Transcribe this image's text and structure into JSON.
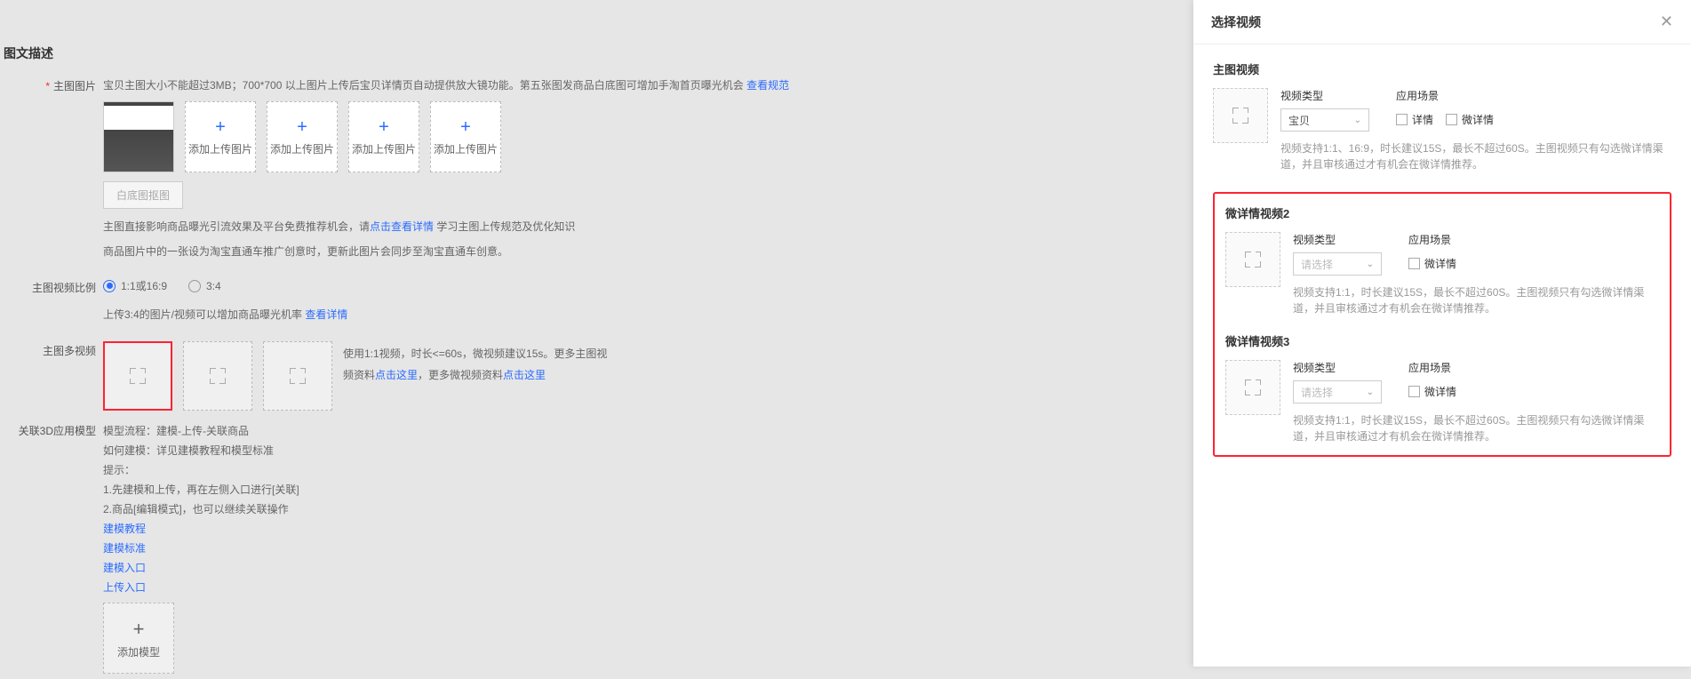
{
  "section_title": "图文描述",
  "main_image": {
    "label": "主图图片",
    "desc": "宝贝主图大小不能超过3MB；700*700 以上图片上传后宝贝详情页自动提供放大镜功能。第五张图发商品白底图可增加手淘首页曝光机会",
    "spec_link": "查看规范",
    "add_label": "添加上传图片",
    "gray_btn": "白底图抠图",
    "hint1_prefix": "主图直接影响商品曝光引流效果及平台免费推荐机会，请",
    "hint1_link": "点击查看详情",
    "hint1_suffix": "学习主图上传规范及优化知识",
    "hint2": "商品图片中的一张设为淘宝直通车推广创意时，更新此图片会同步至淘宝直通车创意。"
  },
  "ratio": {
    "label": "主图视频比例",
    "opt1": "1:1或16:9",
    "opt2": "3:4",
    "hint_prefix": "上传3:4的图片/视频可以增加商品曝光机率",
    "hint_link": "查看详情"
  },
  "multi_video": {
    "label": "主图多视频",
    "desc_prefix": "使用1:1视频，时长<=60s，微视频建议15s。更多主图视",
    "desc_mid": "频资料",
    "link1": "点击这里",
    "desc_suffix": "，更多微视频资料",
    "link2": "点击这里"
  },
  "model3d": {
    "label": "关联3D应用模型",
    "flow_label": "模型流程：",
    "flow_value": "建模-上传-关联商品",
    "how_label": "如何建模：",
    "how_value": "详见建模教程和模型标准",
    "tip_label": "提示：",
    "tip1": "1.先建模和上传，再在左侧入口进行[关联]",
    "tip2": "2.商品[编辑模式]，也可以继续关联操作",
    "link1": "建模教程",
    "link2": "建模标准",
    "link3": "建模入口",
    "link4": "上传入口",
    "add_label": "添加模型"
  },
  "panel": {
    "title": "选择视频",
    "sections": [
      {
        "title": "主图视频",
        "type_label": "视频类型",
        "type_value": "宝贝",
        "scene_label": "应用场景",
        "checks": [
          "详情",
          "微详情"
        ],
        "hint": "视频支持1:1、16:9，时长建议15S，最长不超过60S。主图视频只有勾选微详情渠道，并且审核通过才有机会在微详情推荐。"
      },
      {
        "title": "微详情视频2",
        "type_label": "视频类型",
        "type_placeholder": "请选择",
        "scene_label": "应用场景",
        "checks": [
          "微详情"
        ],
        "hint": "视频支持1:1，时长建议15S，最长不超过60S。主图视频只有勾选微详情渠道，并且审核通过才有机会在微详情推荐。"
      },
      {
        "title": "微详情视频3",
        "type_label": "视频类型",
        "type_placeholder": "请选择",
        "scene_label": "应用场景",
        "checks": [
          "微详情"
        ],
        "hint": "视频支持1:1，时长建议15S，最长不超过60S。主图视频只有勾选微详情渠道，并且审核通过才有机会在微详情推荐。"
      }
    ]
  }
}
